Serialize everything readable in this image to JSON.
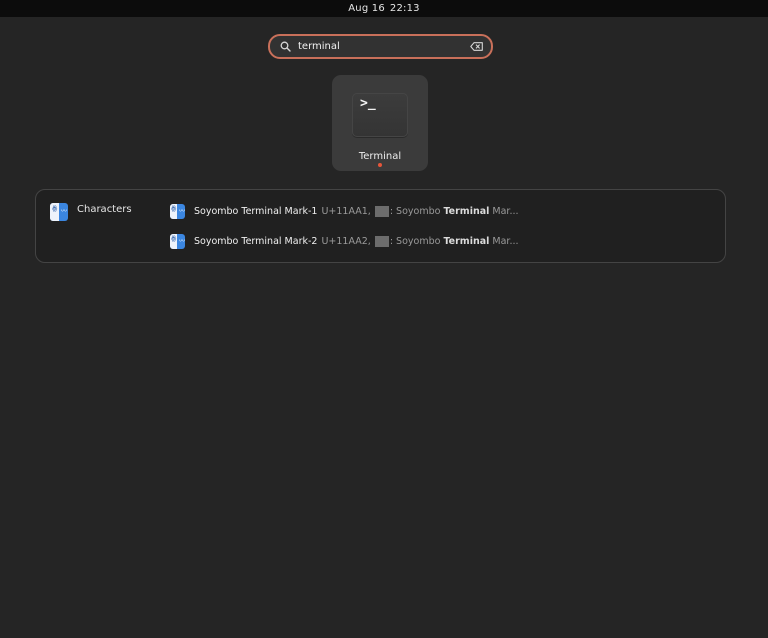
{
  "topbar": {
    "date": "Aug 16",
    "time": "22:13"
  },
  "search": {
    "query": "terminal",
    "clear_icon": "backspace-clear-icon",
    "search_icon": "magnifier-icon"
  },
  "apps": [
    {
      "label": "Terminal",
      "icon": "terminal-icon",
      "prompt_glyph": ">_",
      "running": true
    }
  ],
  "providers": {
    "characters": {
      "label": "Characters",
      "icon": "characters-app-icon",
      "results": [
        {
          "name": "Soyombo Terminal Mark-1",
          "code": "U+11AA1,",
          "desc_prefix": ": Soyombo ",
          "desc_match": "Terminal",
          "desc_suffix": " Mar..."
        },
        {
          "name": "Soyombo Terminal Mark-2",
          "code": "U+11AA2,",
          "desc_prefix": ": Soyombo ",
          "desc_match": "Terminal",
          "desc_suffix": " Mar..."
        }
      ]
    }
  },
  "colors": {
    "accent_focus": "#c9705a",
    "running_dot": "#e8563a",
    "background": "#252525"
  }
}
